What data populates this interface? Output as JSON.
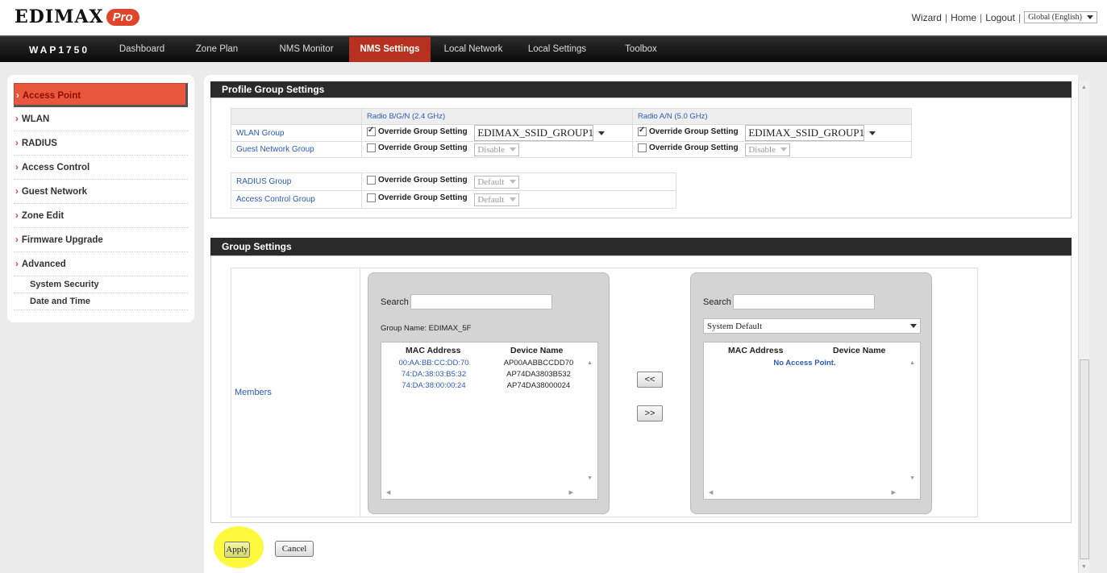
{
  "header": {
    "logo_text": "EDIMAX",
    "logo_badge": "Pro",
    "links": [
      "Wizard",
      "Home",
      "Logout"
    ],
    "language": "Global (English)"
  },
  "nav": {
    "model": "WAP1750",
    "items": [
      "Dashboard",
      "Zone Plan",
      "NMS Monitor",
      "NMS Settings",
      "Local Network",
      "Local Settings",
      "Toolbox"
    ],
    "active": "NMS Settings"
  },
  "sidebar": {
    "items": [
      "Access Point",
      "WLAN",
      "RADIUS",
      "Access Control",
      "Guest Network",
      "Zone Edit",
      "Firmware Upgrade",
      "Advanced"
    ],
    "sub_items": [
      "System Security",
      "Date and Time"
    ],
    "active": "Access Point"
  },
  "profile": {
    "title": "Profile Group Settings",
    "col_24": "Radio B/G/N (2.4 GHz)",
    "col_5": "Radio A/N (5.0 GHz)",
    "override_label": "Override Group Setting",
    "rows": [
      {
        "label": "WLAN Group",
        "v24": "EDIMAX_SSID_GROUP1",
        "v5": "EDIMAX_SSID_GROUP1",
        "checked24": true,
        "checked5": true
      },
      {
        "label": "Guest Network Group",
        "v24": "Disable",
        "v5": "Disable",
        "checked24": false,
        "checked5": false
      }
    ],
    "rows2": [
      {
        "label": "RADIUS Group",
        "value": "Default",
        "checked": false
      },
      {
        "label": "Access Control Group",
        "value": "Default",
        "checked": false
      }
    ]
  },
  "group": {
    "title": "Group Settings",
    "members_label": "Members",
    "left": {
      "search_label": "Search",
      "search_value": "",
      "group_name": "Group Name: EDIMAX_5F",
      "col_mac": "MAC Address",
      "col_name": "Device Name",
      "rows": [
        {
          "mac": "00:AA:BB:CC:DD:70",
          "name": "AP00AABBCCDD70"
        },
        {
          "mac": "74:DA:38:03:B5:32",
          "name": "AP74DA3803B532"
        },
        {
          "mac": "74:DA:38:00:00:24",
          "name": "AP74DA38000024"
        }
      ]
    },
    "right": {
      "search_label": "Search",
      "search_value": "",
      "select_value": "System Default",
      "col_mac": "MAC Address",
      "col_name": "Device Name",
      "empty_text": "No Access Point."
    },
    "move_left": "<<",
    "move_right": ">>"
  },
  "actions": {
    "apply": "Apply",
    "cancel": "Cancel"
  }
}
